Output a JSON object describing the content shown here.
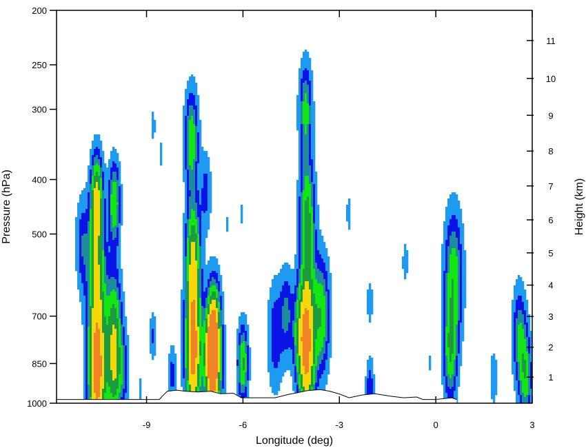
{
  "chart_data": {
    "type": "contour-cross-section",
    "title": "",
    "xlabel": "Longitude (deg)",
    "ylabel_left": "Pressure (hPa)",
    "ylabel_right": "Height (km)",
    "xlim": [
      -11.8,
      3.0
    ],
    "pressure_lim": [
      1000,
      200
    ],
    "pressure_scale": "log",
    "grid": false,
    "x_ticks": [
      {
        "value": -9,
        "label": "-9"
      },
      {
        "value": -6,
        "label": "-6"
      },
      {
        "value": -3,
        "label": "-3"
      },
      {
        "value": 0,
        "label": "0"
      },
      {
        "value": 3,
        "label": "3"
      }
    ],
    "pressure_ticks": [
      {
        "value": 1000,
        "label": "1000"
      },
      {
        "value": 850,
        "label": "850"
      },
      {
        "value": 700,
        "label": "700"
      },
      {
        "value": 500,
        "label": "500"
      },
      {
        "value": 400,
        "label": "400"
      },
      {
        "value": 300,
        "label": "300"
      },
      {
        "value": 250,
        "label": "250"
      },
      {
        "value": 200,
        "label": "200"
      }
    ],
    "height_ticks": [
      {
        "value": 1,
        "label": "1"
      },
      {
        "value": 2,
        "label": "2"
      },
      {
        "value": 3,
        "label": "3"
      },
      {
        "value": 4,
        "label": "4"
      },
      {
        "value": 5,
        "label": "5"
      },
      {
        "value": 6,
        "label": "6"
      },
      {
        "value": 7,
        "label": "7"
      },
      {
        "value": 8,
        "label": "8"
      },
      {
        "value": 9,
        "label": "9"
      },
      {
        "value": 10,
        "label": "10"
      },
      {
        "value": 11,
        "label": "11"
      }
    ],
    "contour_levels": [
      {
        "color": "#1e9bf0"
      },
      {
        "color": "#0a14e6"
      },
      {
        "color": "#1e8c9c"
      },
      {
        "color": "#14e614"
      },
      {
        "color": "#1e9b3c"
      },
      {
        "color": "#f5d70a"
      },
      {
        "color": "#f08228"
      }
    ],
    "cells": [
      {
        "lon": -11.0,
        "pres": 520,
        "h": 0.25,
        "sigma": 0.85
      },
      {
        "lon": -10.55,
        "pres": 430,
        "h": 0.62,
        "sigma": 0.8
      },
      {
        "lon": -10.55,
        "pres": 560,
        "h": 0.32,
        "sigma": 1.05
      },
      {
        "lon": -10.55,
        "pres": 900,
        "h": 0.52,
        "sigma": 1.0
      },
      {
        "lon": -10.5,
        "pres": 930,
        "h": 0.32,
        "sigma": 1.35
      },
      {
        "lon": -10.55,
        "pres": 680,
        "h": 0.38,
        "sigma": 1.25
      },
      {
        "lon": -10.0,
        "pres": 440,
        "h": 0.48,
        "sigma": 0.75
      },
      {
        "lon": -10.0,
        "pres": 720,
        "h": 0.45,
        "sigma": 1.0
      },
      {
        "lon": -10.0,
        "pres": 900,
        "h": 0.42,
        "sigma": 0.9
      },
      {
        "lon": -9.7,
        "pres": 880,
        "h": 0.22,
        "sigma": 0.7
      },
      {
        "lon": -9.2,
        "pres": 940,
        "h": 0.12,
        "sigma": 0.3
      },
      {
        "lon": -8.8,
        "pres": 320,
        "h": 0.12,
        "sigma": 0.4
      },
      {
        "lon": -8.55,
        "pres": 360,
        "h": 0.1,
        "sigma": 0.45
      },
      {
        "lon": -8.8,
        "pres": 760,
        "h": 0.2,
        "sigma": 0.45
      },
      {
        "lon": -8.2,
        "pres": 890,
        "h": 0.22,
        "sigma": 0.55
      },
      {
        "lon": -7.6,
        "pres": 340,
        "h": 0.45,
        "sigma": 0.9
      },
      {
        "lon": -7.55,
        "pres": 540,
        "h": 0.58,
        "sigma": 0.95
      },
      {
        "lon": -7.55,
        "pres": 720,
        "h": 0.55,
        "sigma": 1.0
      },
      {
        "lon": -7.55,
        "pres": 880,
        "h": 0.6,
        "sigma": 1.0
      },
      {
        "lon": -7.15,
        "pres": 420,
        "h": 0.22,
        "sigma": 0.7
      },
      {
        "lon": -7.0,
        "pres": 820,
        "h": 0.55,
        "sigma": 0.85
      },
      {
        "lon": -6.9,
        "pres": 880,
        "h": 0.6,
        "sigma": 1.05
      },
      {
        "lon": -6.9,
        "pres": 720,
        "h": 0.5,
        "sigma": 0.85
      },
      {
        "lon": -6.5,
        "pres": 480,
        "h": 0.1,
        "sigma": 0.3
      },
      {
        "lon": -6.05,
        "pres": 460,
        "h": 0.1,
        "sigma": 0.35
      },
      {
        "lon": -6.0,
        "pres": 850,
        "h": 0.5,
        "sigma": 0.7
      },
      {
        "lon": -5.0,
        "pres": 760,
        "h": 0.25,
        "sigma": 1.0
      },
      {
        "lon": -4.65,
        "pres": 690,
        "h": 0.28,
        "sigma": 0.8
      },
      {
        "lon": -4.25,
        "pres": 760,
        "h": 0.35,
        "sigma": 0.9
      },
      {
        "lon": -4.05,
        "pres": 300,
        "h": 0.4,
        "sigma": 0.85
      },
      {
        "lon": -4.0,
        "pres": 460,
        "h": 0.5,
        "sigma": 1.0
      },
      {
        "lon": -4.0,
        "pres": 680,
        "h": 0.55,
        "sigma": 1.05
      },
      {
        "lon": -4.0,
        "pres": 880,
        "h": 0.6,
        "sigma": 1.0
      },
      {
        "lon": -3.55,
        "pres": 700,
        "h": 0.45,
        "sigma": 1.05
      },
      {
        "lon": -2.7,
        "pres": 460,
        "h": 0.12,
        "sigma": 0.45
      },
      {
        "lon": -2.05,
        "pres": 660,
        "h": 0.12,
        "sigma": 0.55
      },
      {
        "lon": -2.05,
        "pres": 940,
        "h": 0.25,
        "sigma": 0.55
      },
      {
        "lon": -0.95,
        "pres": 560,
        "h": 0.12,
        "sigma": 0.5
      },
      {
        "lon": -0.2,
        "pres": 850,
        "h": 0.1,
        "sigma": 0.3
      },
      {
        "lon": 0.55,
        "pres": 600,
        "h": 0.45,
        "sigma": 1.2
      },
      {
        "lon": 0.45,
        "pres": 820,
        "h": 0.4,
        "sigma": 0.9
      },
      {
        "lon": 1.8,
        "pres": 900,
        "h": 0.14,
        "sigma": 0.6
      },
      {
        "lon": 2.6,
        "pres": 760,
        "h": 0.35,
        "sigma": 0.9
      },
      {
        "lon": 2.8,
        "pres": 900,
        "h": 0.4,
        "sigma": 0.8
      }
    ],
    "terrain": [
      [
        -11.8,
        985
      ],
      [
        -9.8,
        985
      ],
      [
        -9.4,
        985
      ],
      [
        -9.0,
        985
      ],
      [
        -8.6,
        985
      ],
      [
        -8.5,
        970
      ],
      [
        -8.35,
        952
      ],
      [
        -8.05,
        948
      ],
      [
        -7.8,
        952
      ],
      [
        -7.4,
        955
      ],
      [
        -7.0,
        952
      ],
      [
        -6.7,
        962
      ],
      [
        -6.3,
        960
      ],
      [
        -6.05,
        978
      ],
      [
        -5.8,
        978
      ],
      [
        -5.0,
        978
      ],
      [
        -4.6,
        965
      ],
      [
        -4.3,
        958
      ],
      [
        -4.0,
        950
      ],
      [
        -3.6,
        946
      ],
      [
        -3.3,
        952
      ],
      [
        -3.0,
        963
      ],
      [
        -2.7,
        978
      ],
      [
        -2.3,
        967
      ],
      [
        -1.9,
        962
      ],
      [
        -1.4,
        972
      ],
      [
        -1.0,
        978
      ],
      [
        -0.6,
        975
      ],
      [
        -0.4,
        985
      ],
      [
        0.0,
        985
      ],
      [
        0.5,
        978
      ],
      [
        0.65,
        985
      ]
    ]
  }
}
